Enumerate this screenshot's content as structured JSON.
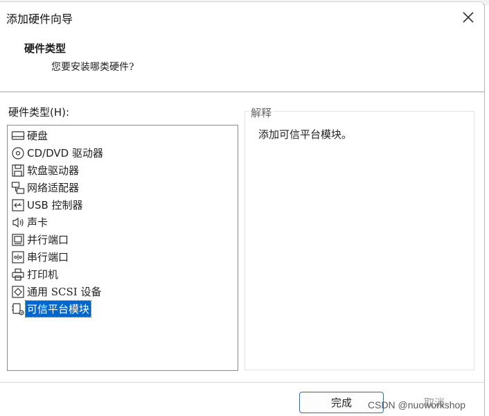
{
  "window": {
    "title": "添加硬件向导",
    "close_icon": "close-icon"
  },
  "header": {
    "title": "硬件类型",
    "subtitle": "您要安装哪类硬件?"
  },
  "hardware_list": {
    "label": "硬件类型(H):",
    "selected_index": 11,
    "items": [
      {
        "label": "硬盘",
        "icon": "hard-disk-icon"
      },
      {
        "label": "CD/DVD 驱动器",
        "icon": "cd-dvd-icon"
      },
      {
        "label": "软盘驱动器",
        "icon": "floppy-icon"
      },
      {
        "label": "网络适配器",
        "icon": "network-adapter-icon"
      },
      {
        "label": "USB 控制器",
        "icon": "usb-icon"
      },
      {
        "label": "声卡",
        "icon": "sound-card-icon"
      },
      {
        "label": "并行端口",
        "icon": "parallel-port-icon"
      },
      {
        "label": "串行端口",
        "icon": "serial-port-icon"
      },
      {
        "label": "打印机",
        "icon": "printer-icon"
      },
      {
        "label": "通用 SCSI 设备",
        "icon": "scsi-icon"
      },
      {
        "label": "可信平台模块",
        "icon": "tpm-icon"
      }
    ]
  },
  "explanation": {
    "legend": "解释",
    "text": "添加可信平台模块。"
  },
  "footer": {
    "finish_label": "完成",
    "cancel_label": "取消"
  },
  "watermark": "CSDN @nuoworkshop",
  "colors": {
    "selection": "#0066cc",
    "finish_border": "#1e6ec8"
  }
}
